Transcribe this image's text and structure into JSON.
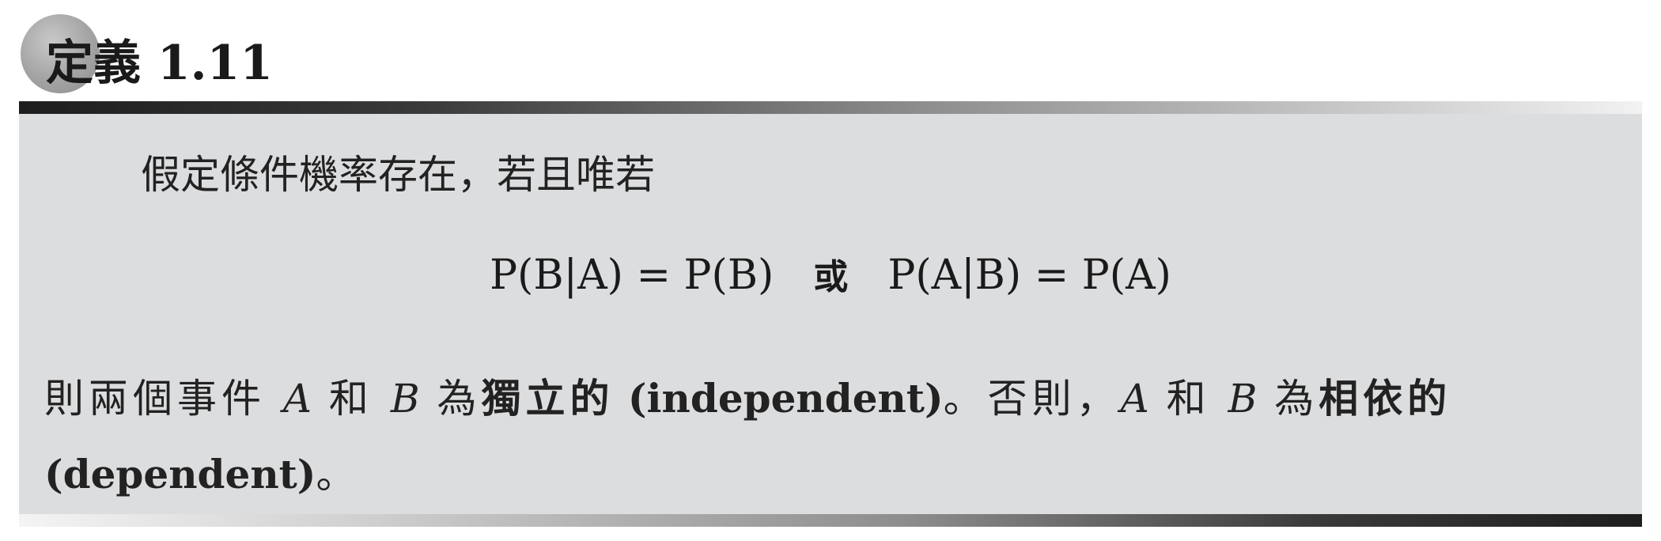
{
  "header": {
    "title": "定義 1.11"
  },
  "body": {
    "intro": "假定條件機率存在，若且唯若",
    "formula": {
      "left": "P(B|A) = P(B)",
      "conj": "或",
      "right": "P(A|B) = P(A)"
    },
    "para": {
      "t1": "則兩個事件 ",
      "var_a1": "A",
      "t2": " 和 ",
      "var_b1": "B",
      "t3": " 為",
      "term1": "獨立的",
      "term1_en": " (independent)",
      "t4": "。否則，",
      "var_a2": "A",
      "t5": " 和 ",
      "var_b2": "B",
      "t6": " 為",
      "term2": "相依的",
      "term2_en": " (dependent)",
      "t7": "。"
    }
  }
}
